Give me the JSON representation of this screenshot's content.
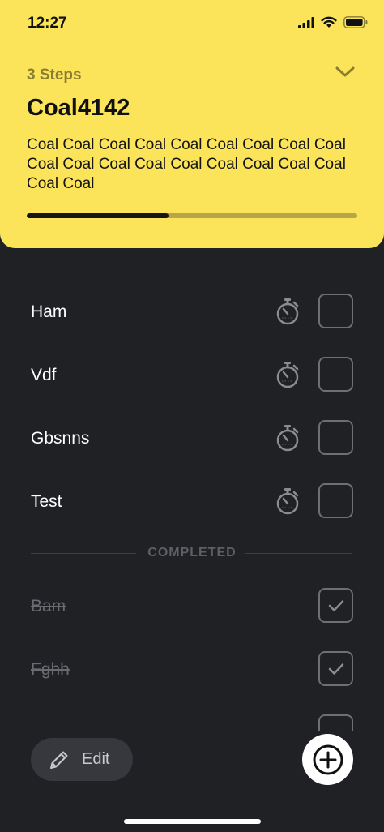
{
  "status_bar": {
    "time": "12:27"
  },
  "header": {
    "steps_label": "3 Steps",
    "title": "Coal4142",
    "description": "Coal Coal Coal Coal Coal Coal Coal Coal Coal Coal Coal Coal Coal Coal Coal Coal Coal Coal Coal Coal",
    "progress_fraction": 0.43,
    "accent_color": "#fbe35a"
  },
  "tasks": [
    {
      "label": "Ham"
    },
    {
      "label": "Vdf"
    },
    {
      "label": "Gbsnns"
    },
    {
      "label": "Test"
    }
  ],
  "completed_section": {
    "label": "COMPLETED",
    "tasks": [
      {
        "label": "Bam"
      },
      {
        "label": "Fghh"
      }
    ]
  },
  "toolbar": {
    "edit_label": "Edit"
  },
  "icons": [
    "stopwatch-icon",
    "checkmark-icon",
    "pencil-icon",
    "plus-circle-icon",
    "chevron-down-icon"
  ]
}
